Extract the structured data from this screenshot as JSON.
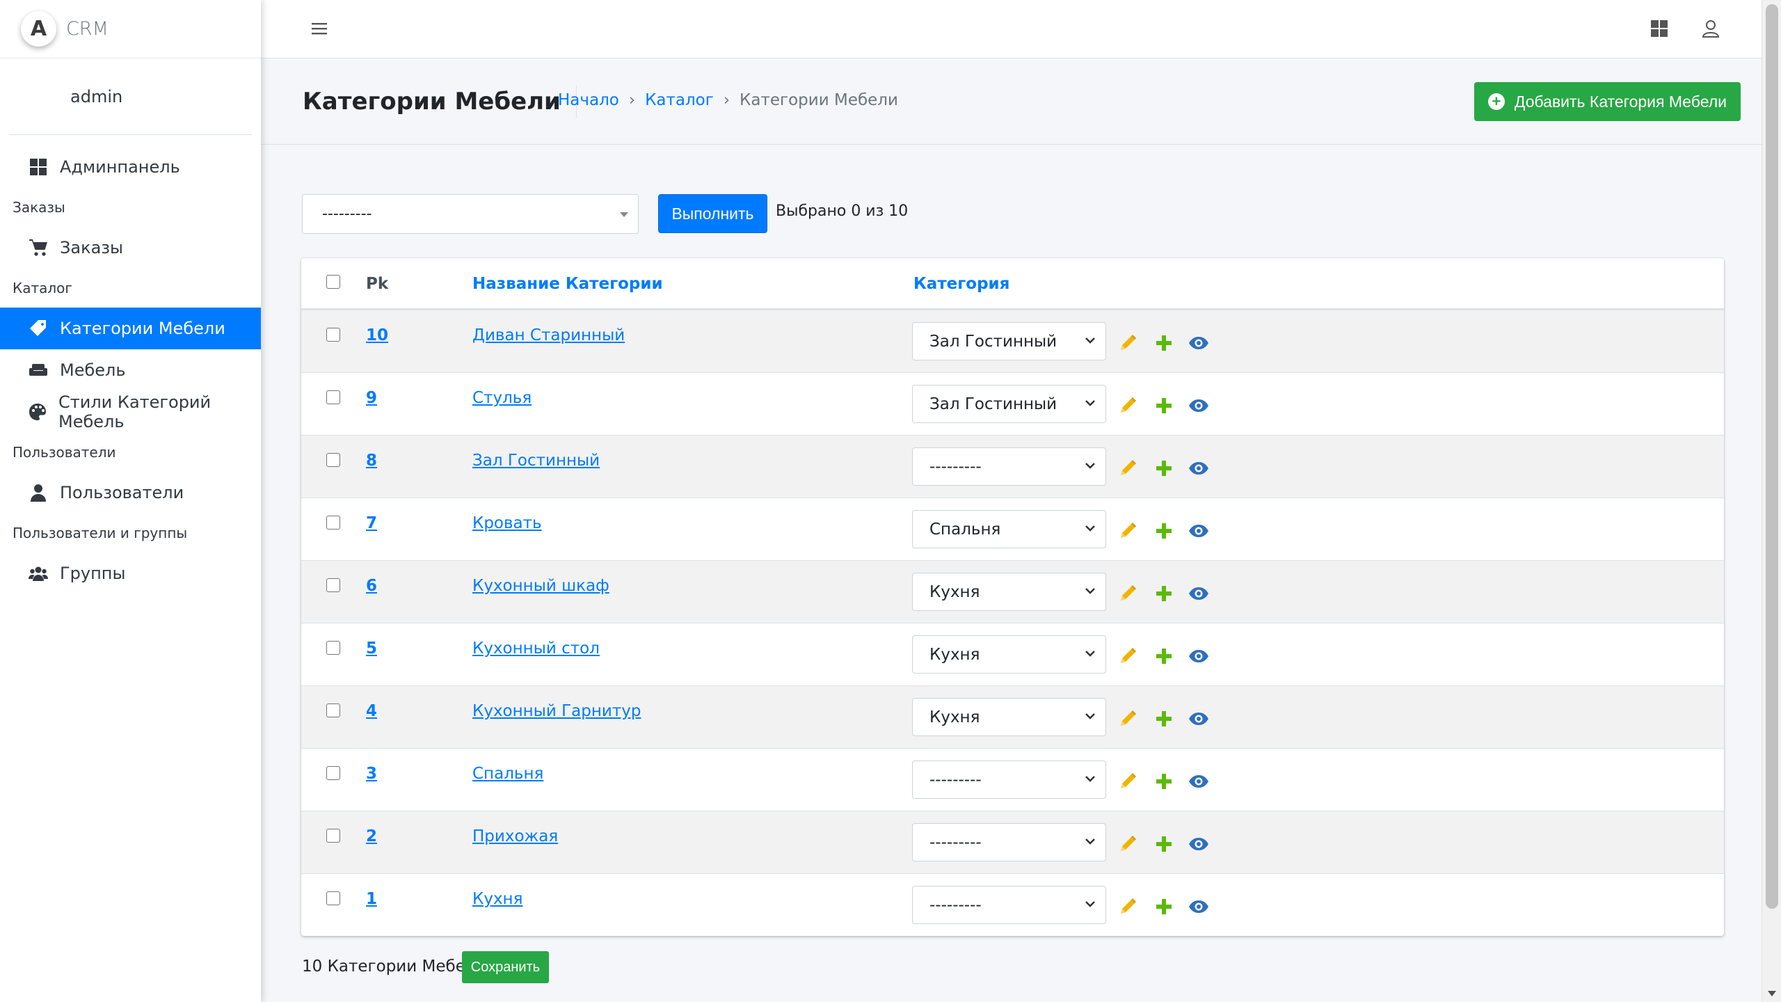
{
  "brand": {
    "logo_letter": "A",
    "name": "CRM"
  },
  "user": {
    "name": "admin"
  },
  "sidebar": {
    "items": [
      {
        "type": "item",
        "label": "Админпанель",
        "icon": "dashboard-icon"
      },
      {
        "type": "header",
        "label": "Заказы"
      },
      {
        "type": "item",
        "label": "Заказы",
        "icon": "cart-icon"
      },
      {
        "type": "header",
        "label": "Каталог"
      },
      {
        "type": "item",
        "label": "Категории Мебели",
        "icon": "tag-icon",
        "active": true
      },
      {
        "type": "item",
        "label": "Мебель",
        "icon": "couch-icon"
      },
      {
        "type": "item",
        "label": "Стили Категорий Мебель",
        "icon": "palette-icon"
      },
      {
        "type": "header",
        "label": "Пользователи"
      },
      {
        "type": "item",
        "label": "Пользователи",
        "icon": "user-icon"
      },
      {
        "type": "header",
        "label": "Пользователи и группы"
      },
      {
        "type": "item",
        "label": "Группы",
        "icon": "users-icon"
      }
    ]
  },
  "header": {
    "title": "Категории Мебели",
    "breadcrumb": {
      "home": "Начало",
      "catalog": "Каталог",
      "current": "Категории Мебели",
      "separator": "›"
    },
    "add_button": "Добавить Категория Мебели"
  },
  "actions": {
    "select_value": "---------",
    "run_button": "Выполнить",
    "selected_text": "Выбрано 0 из 10"
  },
  "table": {
    "columns": {
      "pk": "Pk",
      "name": "Название Категории",
      "category": "Категория"
    },
    "rows": [
      {
        "pk": "10",
        "name": "Диван Старинный",
        "category": "Зал Гостинный"
      },
      {
        "pk": "9",
        "name": "Стулья",
        "category": "Зал Гостинный"
      },
      {
        "pk": "8",
        "name": "Зал Гостинный",
        "category": "---------"
      },
      {
        "pk": "7",
        "name": "Кровать",
        "category": "Спальня"
      },
      {
        "pk": "6",
        "name": "Кухонный шкаф",
        "category": "Кухня"
      },
      {
        "pk": "5",
        "name": "Кухонный стол",
        "category": "Кухня"
      },
      {
        "pk": "4",
        "name": "Кухонный Гарнитур",
        "category": "Кухня"
      },
      {
        "pk": "3",
        "name": "Спальня",
        "category": "---------"
      },
      {
        "pk": "2",
        "name": "Прихожая",
        "category": "---------"
      },
      {
        "pk": "1",
        "name": "Кухня",
        "category": "---------"
      }
    ]
  },
  "footer": {
    "count_text": "10 Категории Мебели",
    "save_button": "Сохранить"
  },
  "colors": {
    "primary": "#007bff",
    "success": "#28a745",
    "edit": "#f0b400",
    "add": "#5cb90a",
    "view": "#2f6fbf"
  }
}
